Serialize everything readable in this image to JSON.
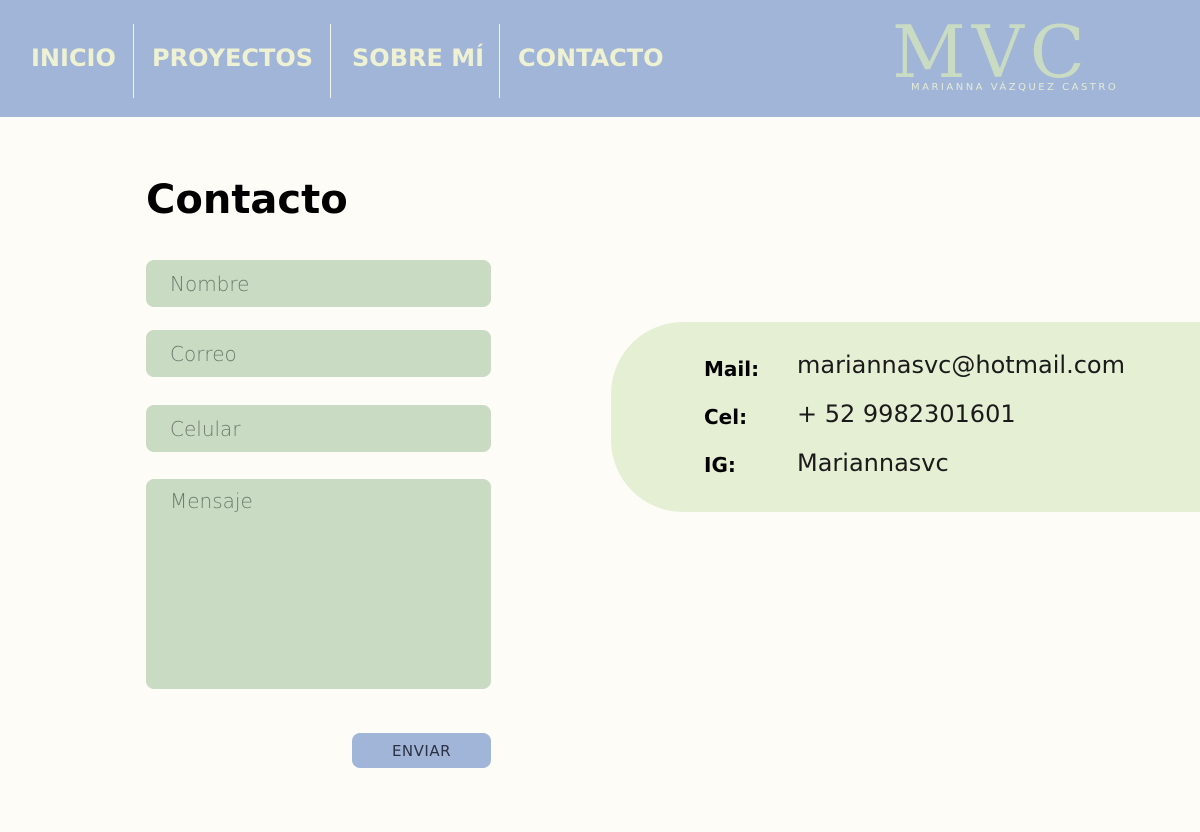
{
  "nav": {
    "items": [
      {
        "label": "INICIO"
      },
      {
        "label": "PROYECTOS"
      },
      {
        "label": "SOBRE MÍ"
      },
      {
        "label": "CONTACTO"
      }
    ]
  },
  "logo": {
    "mark": "MVC",
    "subtitle": "MARIANNA VÁZQUEZ CASTRO"
  },
  "page": {
    "title": "Contacto"
  },
  "form": {
    "name_placeholder": "Nombre",
    "email_placeholder": "Correo",
    "phone_placeholder": "Celular",
    "message_placeholder": "Mensaje",
    "submit_label": "ENVIAR"
  },
  "contact_info": {
    "mail_label": "Mail:",
    "mail_value": "mariannasvc@hotmail.com",
    "cel_label": "Cel:",
    "cel_value": "+ 52 9982301601",
    "ig_label": "IG:",
    "ig_value": "Mariannasvc"
  },
  "colors": {
    "navbar": "#a1b5d8",
    "nav_text": "#eef1d2",
    "page_bg": "#fefcf7",
    "field_bg": "#c9dbc2",
    "card_bg": "#e4efd4",
    "button_bg": "#a1b5d8"
  }
}
